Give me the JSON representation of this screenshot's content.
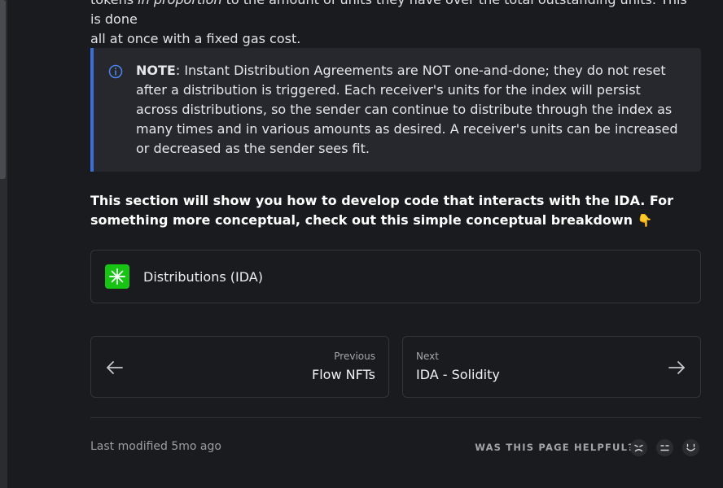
{
  "intro": {
    "line1_start": "tokens ",
    "line1_em": "in proportion",
    "line1_end": " to the amount of units they have over the total outstanding units. This is done",
    "line2": "all at once with a fixed gas cost."
  },
  "note": {
    "label": "NOTE",
    "text": ": Instant Distribution Agreements are NOT one-and-done; they do not reset after a distribution is triggered. Each receiver's units for the index will persist across distributions, so the sender can continue to distribute through the index as many times and in various amounts as desired. A receiver's units can be increased or decreased as the sender sees fit.",
    "icon": "info-icon"
  },
  "lead": {
    "text": "This section will show you how to develop code that interacts with the IDA. For something more conceptual, check out this simple conceptual breakdown",
    "emoji": "👇"
  },
  "card": {
    "label": "Distributions (IDA)",
    "icon": "sparkle-icon",
    "icon_color": "#17c414"
  },
  "pager": {
    "prev": {
      "small": "Previous",
      "title": "Flow NFTs"
    },
    "next": {
      "small": "Next",
      "title": "IDA - Solidity"
    }
  },
  "footer": {
    "modified": "Last modified 5mo ago",
    "helpful": "WAS THIS PAGE HELPFUL?"
  },
  "colors": {
    "background": "#1a1b1e",
    "accent": "#3a6fd8",
    "note_bg": "#26282e"
  }
}
